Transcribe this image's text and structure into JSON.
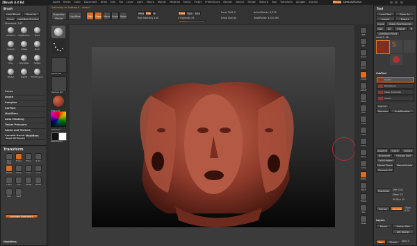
{
  "app": {
    "title": "ZBrush 4.0 R4",
    "top_menu": [
      "Alpha",
      "Brush",
      "Color",
      "Document",
      "Draw",
      "Edit",
      "File",
      "Layer",
      "Light",
      "Macro",
      "Marker",
      "Material",
      "Movie",
      "Picker",
      "Preferences",
      "Render",
      "Stencil",
      "Stroke",
      "Texture",
      "Tool",
      "Transform",
      "Zplugin",
      "Zscript"
    ],
    "menus_label": "Menus",
    "default_script": "DefaultZScript",
    "status_message": "Switching to Subtool 6 - mesh1"
  },
  "top_toolbar": {
    "left_buttons": [
      "Projection Master",
      "LightBox"
    ],
    "mode_buttons": [
      {
        "label": "Edit",
        "active": true
      },
      {
        "label": "Draw",
        "active": true
      },
      {
        "label": "Move",
        "active": false
      },
      {
        "label": "Scale",
        "active": false
      },
      {
        "label": "Rotate",
        "active": false
      }
    ],
    "mrgb": "Mrgb",
    "rgb": "Rgb",
    "m": "M",
    "zadd": "Zadd",
    "zsub": "Zsub",
    "zcut": "Zcut",
    "rgb_intensity": "Rgb Intensity 100",
    "z_intensity": "Z Intensity 25",
    "focal_shift": "Focal Shift 0",
    "draw_size": "Draw Size 64",
    "active_points": "ActivePoints: 6,376",
    "total_points": "TotalPoints: 4.321 Mil"
  },
  "left_panel": {
    "brush_title": "Brush",
    "load_brush": "Load Brush",
    "save_as": "Save As",
    "clone": "Clone",
    "lightbox_brushes": "LightBox>Brushes",
    "standard_label": "Standard. 147",
    "brush_names": [
      "Standard",
      "ClayBuildup",
      "Move",
      "Smooth",
      "Inflate",
      "Pinch",
      "Clay",
      "ClayTubes",
      "Flatten",
      "hPolish",
      "Slash3",
      "TrimDynamic"
    ],
    "sections": [
      "Curve",
      "Depth",
      "Samples",
      "Surface",
      "Modifiers",
      "Auto Masking",
      "Tablet Pressure",
      "Alpha and Texture",
      "Smooth Brush Modifiers"
    ],
    "reset_all": "Reset All Brushes",
    "transform_title": "Transform",
    "transform_buttons": [
      "Save View",
      "Frame",
      "Move",
      "Scale",
      "Rotate",
      "Persp",
      "Floor",
      "Local",
      "L.Sym",
      "Xyz",
      "Transp",
      "Ghost",
      "Solo",
      "PolyF"
    ],
    "activate_symmetry": "Activate Symmetry",
    "modifiers": "Modifiers"
  },
  "shelf": {
    "alpha_label": "Alpha Off",
    "texture_label": "Texture Off",
    "material_label": "Material",
    "gradient_label": "Gradient",
    "switch_color": "SwitchColor"
  },
  "right_icons": [
    "BPR",
    "SPix",
    "Scroll",
    "Zoom",
    "Actual",
    "AAHalf",
    "Persp",
    "Floor",
    "Local",
    "L.Sym",
    "Frame",
    "Move",
    "Scale",
    "Rotate",
    "PolyF",
    "Transp",
    "Solo",
    "Xpose"
  ],
  "tool_panel": {
    "title": "Tool",
    "load_tool": "Load Tool",
    "save_as": "Save As",
    "import": "Import",
    "export": "Export",
    "clone": "Clone",
    "make_polymesh": "Make PolyMesh3D",
    "goz": "GoZ",
    "all": "All",
    "visible": "Visible",
    "r": "R",
    "lightbox_tools": "LightBox>Tools",
    "mesh_label": "mesh1. 48",
    "subtool_title": "SubTool",
    "subtools": [
      {
        "name": "mesh1",
        "active": true
      },
      {
        "name": "PolySphere",
        "active": false
      },
      {
        "name": "Mesh_Extract6K",
        "active": false
      },
      {
        "name": "mesh1",
        "active": false
      }
    ],
    "list_all": "List All",
    "rename": "Rename",
    "auto_reorder": "AutoReorder",
    "append": "Append",
    "insert": "Insert",
    "delete": "Delete",
    "duplicate": "Duplicate",
    "group_split": "Groups Split",
    "split_hidden": "Split Hidden",
    "merge_down": "Merge Down",
    "merge_visible": "MergeVisible",
    "remesh_all": "Remesh All",
    "distribution": "Distribution",
    "extract": "Extract",
    "accept": "Accept",
    "thick": "Thick 0.02",
    "e_smt": "E Smt 5",
    "s_smt": "S Smt 5",
    "layers_title": "Layers",
    "layers_sub": [
      "Name",
      "Higher Res"
    ],
    "rec_label": "Rec",
    "geometry": "Geometry",
    "deformation": "Deformation",
    "project_all": "ProjectAll",
    "sdiv": "SDiv 1",
    "higher_res": "Higher Res",
    "del_higher": "Del Higher",
    "divide": "Divide",
    "smt": "Smt",
    "res": "Res 128",
    "polish": "Polish 0",
    "dist": "Dist 0.01",
    "mean": "Mean 25",
    "pa_blur": "PA Blur 10",
    "projection_shell": "ProjectionShell 0",
    "farthest": "Farthest",
    "outer": "Outer",
    "inner": "Inner"
  },
  "colors": {
    "accent": "#e0762a",
    "panel": "#3a3a3a",
    "bg": "#2b2b2b",
    "model": "#9a3e2c"
  }
}
